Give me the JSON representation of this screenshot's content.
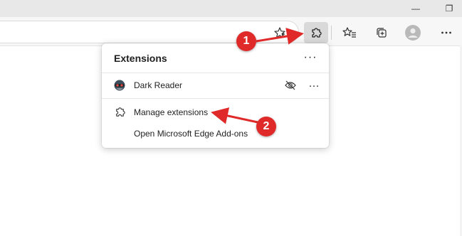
{
  "window": {
    "minimize_glyph": "—",
    "restore_glyph": "❐"
  },
  "toolbar": {
    "icons": [
      "favorites-star-icon",
      "extensions-puzzle-icon",
      "favorites-list-icon",
      "collections-icon",
      "profile-avatar-icon",
      "settings-more-icon"
    ]
  },
  "extensions_menu": {
    "title": "Extensions",
    "more_label": "···",
    "items": [
      {
        "label": "Dark Reader",
        "more_label": "···"
      },
      {
        "label": "Manage extensions"
      },
      {
        "label": "Open Microsoft Edge Add-ons"
      }
    ]
  },
  "annotations": {
    "step1": "1",
    "step2": "2",
    "color": "#e02a2a"
  }
}
